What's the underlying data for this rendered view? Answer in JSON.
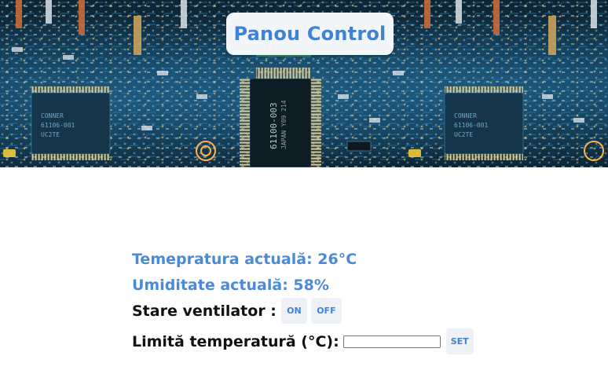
{
  "header": {
    "title": "Panou Control",
    "accent_color": "#3f83d6"
  },
  "readings": {
    "temperature": "Temepratura actuală: 26°C",
    "humidity": "Umiditate actuală: 58%"
  },
  "fan": {
    "label": "Stare ventilator :",
    "on_label": "ON",
    "off_label": "OFF"
  },
  "temperature_limit": {
    "label": "Limită temperatură (°C):",
    "value": "",
    "placeholder": "",
    "set_label": "SET"
  }
}
